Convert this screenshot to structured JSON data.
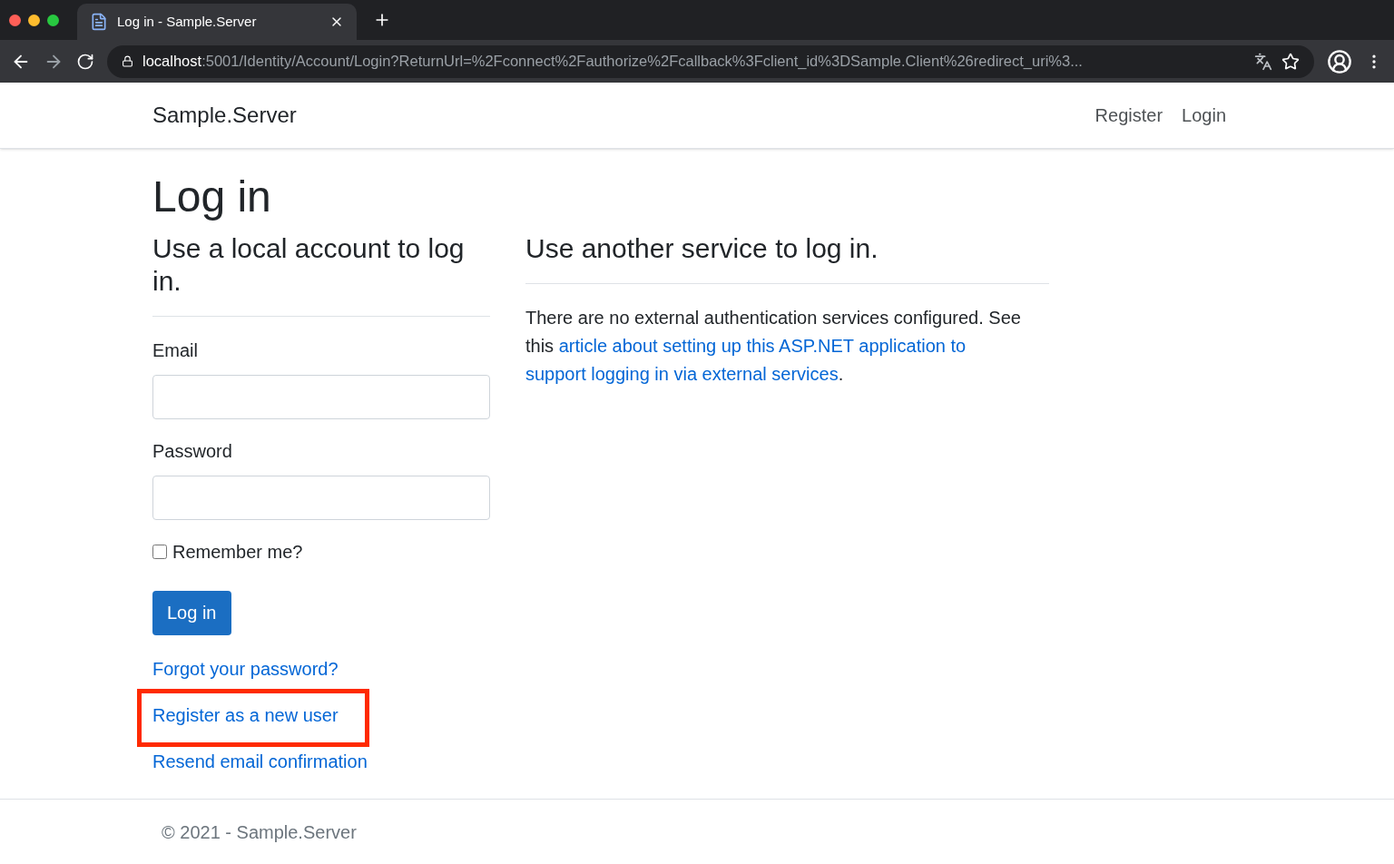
{
  "browser": {
    "tab": {
      "title": "Log in - Sample.Server",
      "selected": true
    },
    "url_host": "localhost",
    "url_rest": ":5001/Identity/Account/Login?ReturnUrl=%2Fconnect%2Fauthorize%2Fcallback%3Fclient_id%3DSample.Client%26redirect_uri%3..."
  },
  "navbar": {
    "brand": "Sample.Server",
    "links": [
      "Register",
      "Login"
    ]
  },
  "page": {
    "title": "Log in",
    "local": {
      "heading": "Use a local account to log in.",
      "fields": [
        {
          "label": "Email"
        },
        {
          "label": "Password"
        }
      ],
      "remember": {
        "label": "Remember me?",
        "checked": false
      },
      "submit": "Log in",
      "links": [
        {
          "text": "Forgot your password?",
          "highlighted": false
        },
        {
          "text": "Register as a new user",
          "highlighted": true
        },
        {
          "text": "Resend email confirmation",
          "highlighted": false
        }
      ]
    },
    "external": {
      "heading": "Use another service to log in.",
      "text_before": "There are no external authentication services configured. See this ",
      "link_lines": [
        "article about setting up this ASP.NET application to",
        "support logging in via external services"
      ],
      "text_after": "."
    }
  },
  "footer": {
    "text": "© 2021 - Sample.Server"
  }
}
